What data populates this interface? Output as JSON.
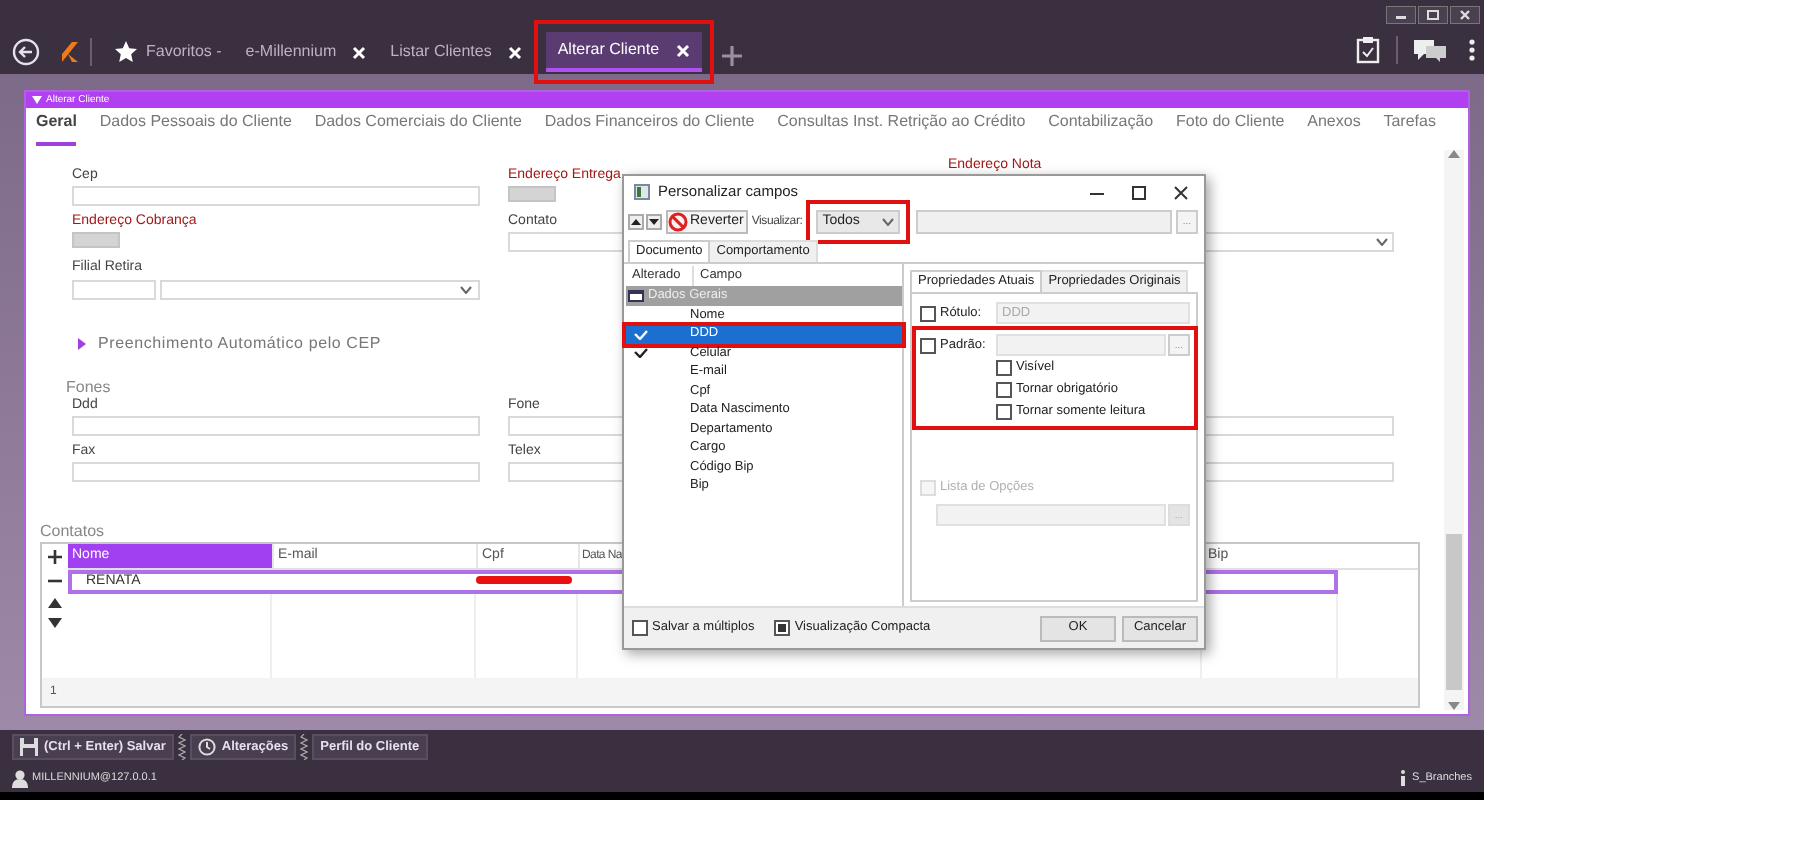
{
  "app_tabs": [
    {
      "label": "Favoritos -",
      "kind": "favorites",
      "selected": false,
      "highlighted": false
    },
    {
      "label": "e-Millennium",
      "kind": "tab",
      "selected": false,
      "highlighted": false
    },
    {
      "label": "Listar Clientes",
      "kind": "tab",
      "selected": false,
      "highlighted": false
    },
    {
      "label": "Alterar Cliente",
      "kind": "tab",
      "selected": true,
      "highlighted": true
    }
  ],
  "panel_title": "Alterar Cliente",
  "section_tabs": [
    {
      "label": "Geral",
      "selected": true
    },
    {
      "label": "Dados Pessoais do Cliente",
      "selected": false
    },
    {
      "label": "Dados Comerciais do Cliente",
      "selected": false
    },
    {
      "label": "Dados Financeiros do Cliente",
      "selected": false
    },
    {
      "label": "Consultas Inst. Retrição ao Crédito",
      "selected": false
    },
    {
      "label": "Contabilização",
      "selected": false
    },
    {
      "label": "Foto do Cliente",
      "selected": false
    },
    {
      "label": "Anexos",
      "selected": false
    },
    {
      "label": "Tarefas",
      "selected": false
    }
  ],
  "form": {
    "rows": [
      [
        {
          "label": "Cep",
          "kind": "text",
          "required": false
        },
        {
          "label": "Endereço Entrega",
          "kind": "lookup",
          "required": true
        },
        {
          "label": "Endereço Nota",
          "kind": "label",
          "required": true
        }
      ],
      [
        {
          "label": "Endereço Cobrança",
          "kind": "lookup",
          "required": true
        },
        {
          "label": "Contato",
          "kind": "select",
          "required": false
        }
      ],
      [
        {
          "label": "Filial Retira",
          "kind": "split_select",
          "required": false
        }
      ]
    ],
    "expander": {
      "label": "Preenchimento Automático pelo CEP",
      "expanded": false
    },
    "group": "Fones",
    "group_rows": [
      [
        {
          "label": "Ddd",
          "kind": "text",
          "required": false
        },
        {
          "label": "Fone",
          "kind": "text",
          "required": false
        }
      ],
      [
        {
          "label": "Fax",
          "kind": "text",
          "required": false
        },
        {
          "label": "Telex",
          "kind": "text",
          "required": false
        }
      ]
    ]
  },
  "contacts": {
    "title": "Contatos",
    "columns": [
      {
        "label": "Nome",
        "selected": true
      },
      {
        "label": "E-mail",
        "selected": false
      },
      {
        "label": "Cpf",
        "selected": false
      },
      {
        "label": "Data Na",
        "selected": false
      },
      {
        "label": "Bip",
        "selected": false
      }
    ],
    "rows": [
      {
        "nome": "RENATA",
        "selected": true,
        "cpf_redacted": true
      }
    ],
    "count": "1"
  },
  "dialog": {
    "title": "Personalizar campos",
    "revert": "Reverter",
    "view_label": "Visualizar:",
    "view_value": "Todos",
    "view_highlighted": true,
    "more": "...",
    "tabs": [
      {
        "label": "Documento",
        "selected": true
      },
      {
        "label": "Comportamento",
        "selected": false
      }
    ],
    "columns": [
      "Alterado",
      "Campo"
    ],
    "tree": [
      {
        "label": "Dados Gerais",
        "children": [
          {
            "label": "Nome",
            "changed": false,
            "selected": false,
            "highlighted": false
          },
          {
            "label": "DDD",
            "changed": true,
            "selected": true,
            "highlighted": true
          },
          {
            "label": "Celular",
            "changed": true,
            "selected": false,
            "highlighted": false
          },
          {
            "label": "E-mail",
            "changed": false,
            "selected": false,
            "highlighted": false
          },
          {
            "label": "Cpf",
            "changed": false,
            "selected": false,
            "highlighted": false
          },
          {
            "label": "Data Nascimento",
            "changed": false,
            "selected": false,
            "highlighted": false
          },
          {
            "label": "Departamento",
            "changed": false,
            "selected": false,
            "highlighted": false
          },
          {
            "label": "Cargo",
            "changed": false,
            "selected": false,
            "highlighted": false
          },
          {
            "label": "Código Bip",
            "changed": false,
            "selected": false,
            "highlighted": false
          },
          {
            "label": "Bip",
            "changed": false,
            "selected": false,
            "highlighted": false
          }
        ]
      }
    ],
    "prop_tabs": [
      {
        "label": "Propriedades Atuais",
        "selected": true
      },
      {
        "label": "Propriedades Originais",
        "selected": false
      }
    ],
    "label_check": {
      "label": "Rótulo:",
      "checked": false,
      "value": "DDD"
    },
    "default_check": {
      "label": "Padrão:",
      "checked": false,
      "more": "..."
    },
    "options": [
      {
        "label": "Visível",
        "checked": false
      },
      {
        "label": "Tornar obrigatório",
        "checked": false
      },
      {
        "label": "Tornar somente leitura",
        "checked": false
      }
    ],
    "options_highlighted": true,
    "list_check": {
      "label": "Lista de Opções",
      "checked": false,
      "disabled": true,
      "more": "..."
    },
    "footer_checks": [
      {
        "label": "Salvar a múltiplos",
        "checked": false
      },
      {
        "label": "Visualização Compacta",
        "checked": true
      }
    ],
    "buttons": [
      "OK",
      "Cancelar"
    ]
  },
  "toolbar": [
    {
      "label": "(Ctrl + Enter) Salvar",
      "kind": "save"
    },
    {
      "label": "Alterações",
      "kind": "history"
    },
    {
      "label": "Perfil do Cliente",
      "kind": "plain"
    }
  ],
  "status": {
    "user": "MILLENNIUM@127.0.0.1",
    "branch": "S_Branches"
  }
}
